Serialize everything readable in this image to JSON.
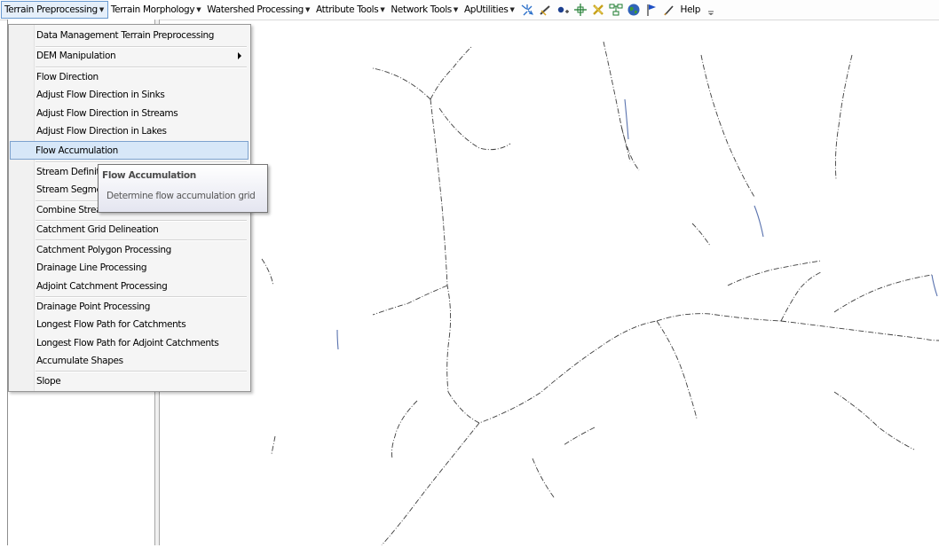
{
  "toolbar": {
    "menus": [
      {
        "label": "Terrain Preprocessing"
      },
      {
        "label": "Terrain Morphology"
      },
      {
        "label": "Watershed Processing"
      },
      {
        "label": "Attribute Tools"
      },
      {
        "label": "Network Tools"
      },
      {
        "label": "ApUtilities"
      }
    ],
    "tools": [
      "flow-path-tracing-icon",
      "edit-tool-icon",
      "point-add-icon",
      "snap-icon",
      "delete-icon",
      "network-icon",
      "globe-icon",
      "flag-icon",
      "pencil-icon"
    ],
    "help_label": "Help"
  },
  "menu": {
    "items": [
      {
        "label": "Data Management Terrain Preprocessing"
      },
      {
        "label": "DEM Manipulation"
      },
      {
        "label": "Flow Direction"
      },
      {
        "label": "Adjust Flow Direction in Sinks"
      },
      {
        "label": "Adjust Flow Direction in Streams"
      },
      {
        "label": "Adjust Flow Direction in Lakes"
      },
      {
        "label": "Flow Accumulation"
      },
      {
        "label": "Stream Definition"
      },
      {
        "label": "Stream Segmentation"
      },
      {
        "label": "Combine Stream Link and Sink Link"
      },
      {
        "label": "Catchment Grid Delineation"
      },
      {
        "label": "Catchment Polygon Processing"
      },
      {
        "label": "Drainage Line Processing"
      },
      {
        "label": "Adjoint Catchment Processing"
      },
      {
        "label": "Drainage Point Processing"
      },
      {
        "label": "Longest Flow Path for Catchments"
      },
      {
        "label": "Longest Flow Path for Adjoint Catchments"
      },
      {
        "label": "Accumulate Shapes"
      },
      {
        "label": "Slope"
      }
    ],
    "highlighted": "Flow Accumulation"
  },
  "tooltip": {
    "title": "Flow Accumulation",
    "description": "Determine flow accumulation grid"
  },
  "colors": {
    "highlight_bg": "#d7e7f8",
    "highlight_border": "#7da2ce",
    "stream_line": "#1a1a1a"
  }
}
